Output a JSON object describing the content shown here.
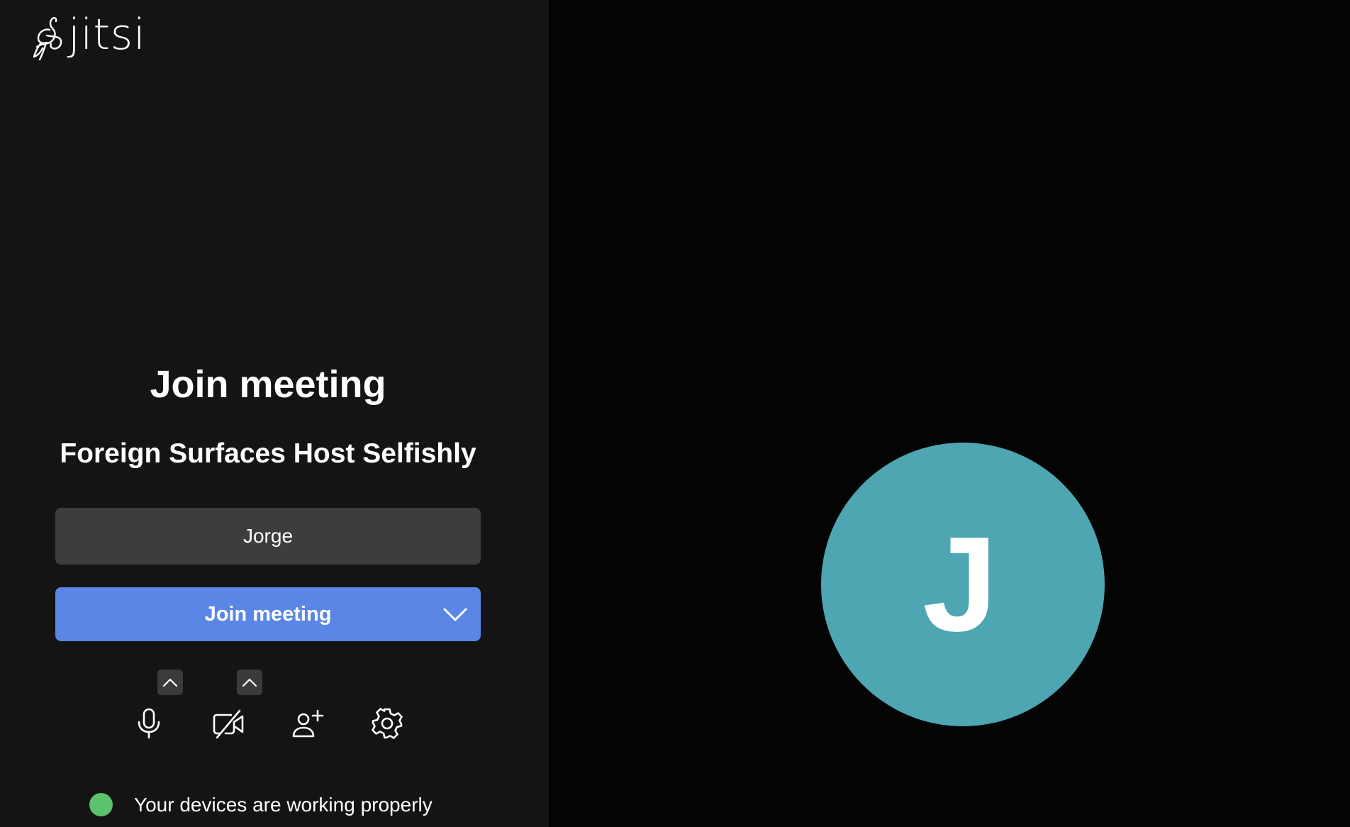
{
  "logo": {
    "text": "jitsi",
    "icon": "jitsi-bird-logo"
  },
  "prejoin": {
    "title": "Join meeting",
    "room_name": "Foreign Surfaces Host Selfishly",
    "name_input": {
      "value": "Jorge",
      "placeholder": ""
    },
    "join_button": {
      "label": "Join meeting",
      "dropdown_icon": "chevron-down-icon"
    },
    "toolbar": [
      {
        "icon": "microphone-icon",
        "has_options": true
      },
      {
        "icon": "video-off-icon",
        "has_options": true
      },
      {
        "icon": "invite-people-icon",
        "has_options": false
      },
      {
        "icon": "gear-icon",
        "has_options": false
      }
    ],
    "status": {
      "text": "Your devices are working properly",
      "color": "#5bc26e"
    }
  },
  "preview": {
    "avatar_initial": "J",
    "avatar_color": "#4da6b2"
  },
  "colors": {
    "panel_bg": "#141414",
    "preview_bg": "#040404",
    "primary": "#5a87e6",
    "input_bg": "#3d3d3d"
  }
}
